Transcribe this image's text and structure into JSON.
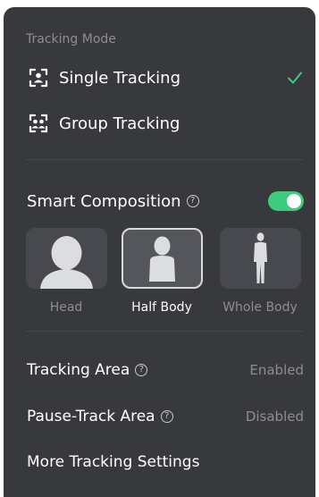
{
  "tracking_mode": {
    "title": "Tracking Mode",
    "options": [
      {
        "label": "Single Tracking",
        "icon": "single-person-frame-icon",
        "selected": true
      },
      {
        "label": "Group Tracking",
        "icon": "group-frame-icon",
        "selected": false
      }
    ]
  },
  "smart_composition": {
    "label": "Smart Composition",
    "enabled": true,
    "toggle_color": "#3ccb7f",
    "options": [
      {
        "label": "Head",
        "icon": "head-silhouette-icon",
        "selected": false
      },
      {
        "label": "Half Body",
        "icon": "half-body-silhouette-icon",
        "selected": true
      },
      {
        "label": "Whole Body",
        "icon": "whole-body-silhouette-icon",
        "selected": false
      }
    ]
  },
  "settings": [
    {
      "label": "Tracking Area",
      "value": "Enabled",
      "has_help": true
    },
    {
      "label": "Pause-Track Area",
      "value": "Disabled",
      "has_help": true
    },
    {
      "label": "More Tracking Settings",
      "value": "",
      "has_help": false
    }
  ],
  "colors": {
    "panel_bg": "#38393d",
    "accent": "#3ccb7f",
    "muted_text": "#8d8e92"
  }
}
